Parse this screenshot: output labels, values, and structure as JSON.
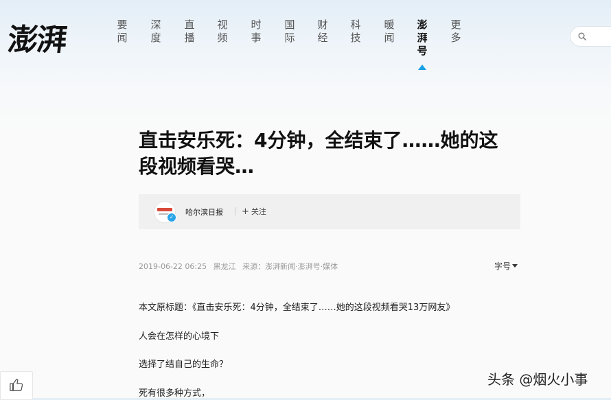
{
  "brand": {
    "logo_text": "澎湃"
  },
  "nav": {
    "items": [
      {
        "label": "要闻"
      },
      {
        "label": "深度"
      },
      {
        "label": "直播"
      },
      {
        "label": "视频"
      },
      {
        "label": "时事"
      },
      {
        "label": "国际"
      },
      {
        "label": "财经"
      },
      {
        "label": "科技"
      },
      {
        "label": "暖闻"
      },
      {
        "label": "澎湃号",
        "active": true
      },
      {
        "label": "更多"
      }
    ],
    "accent": "#1aa0e6"
  },
  "search": {
    "icon": "search-icon"
  },
  "article": {
    "title_line1": "直击安乐死：4分钟，全结束了……她的这",
    "title_line2": "段视频看哭…",
    "author": {
      "name": "哈尔滨日报",
      "follow_label": "关注",
      "verified": true
    },
    "meta": {
      "date": "2019-06-22 06:25",
      "region": "黑龙江",
      "source": "来源：澎湃新闻·澎湃号·媒体"
    },
    "font_size_label": "字号",
    "paragraphs": [
      "本文原标题：《直击安乐死：4分钟，全结束了……她的这段视频看哭13万网友》",
      "人会在怎样的心境下",
      "选择了结自己的生命？",
      "死有很多种方式，"
    ]
  },
  "sidebar": {
    "like_icon": "thumbs-up-icon"
  },
  "watermark": {
    "text": "头条 @烟火小事"
  }
}
